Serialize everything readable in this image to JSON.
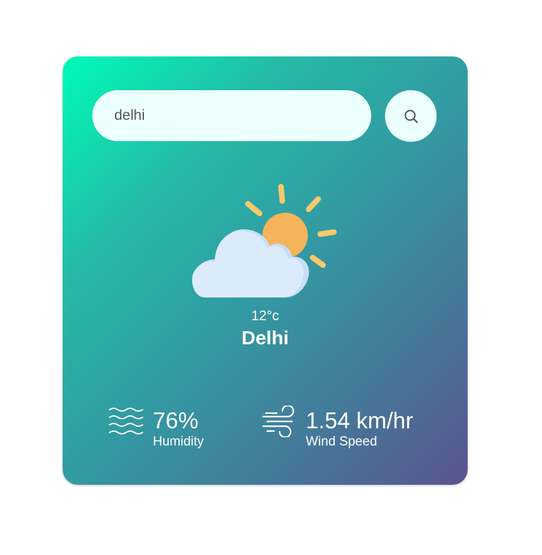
{
  "search": {
    "value": "delhi"
  },
  "weather": {
    "icon": "sun-behind-cloud-icon",
    "temperature": "12°c",
    "city": "Delhi"
  },
  "humidity": {
    "icon": "humidity-waves-icon",
    "value": "76%",
    "label": "Humidity"
  },
  "wind": {
    "icon": "wind-icon",
    "value": "1.54 km/hr",
    "label": "Wind Speed"
  },
  "colors": {
    "gradient_start": "#00fbb8",
    "gradient_end": "#5b548d",
    "field_background": "#ebfffc",
    "sun": "#f5b45a",
    "cloud": "#dcebfb"
  }
}
